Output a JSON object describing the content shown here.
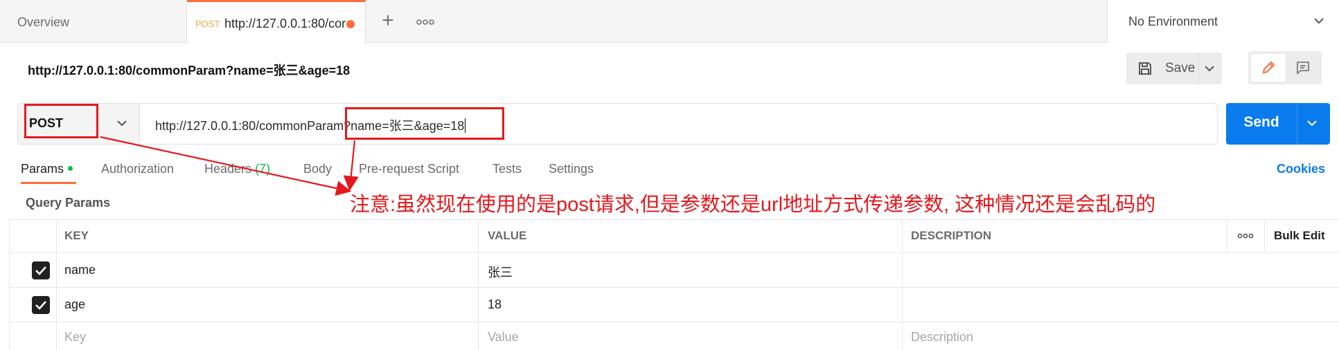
{
  "tabs": {
    "overview_label": "Overview",
    "active": {
      "method": "POST",
      "url": "http://127.0.0.1:80/cor"
    },
    "add_symbol": "+",
    "environment": "No Environment"
  },
  "request": {
    "name": "http://127.0.0.1:80/commonParam?name=张三&age=18",
    "method": "POST",
    "url": "http://127.0.0.1:80/commonParam?name=张三&age=18",
    "save_label": "Save",
    "send_label": "Send"
  },
  "request_tabs": {
    "params": "Params",
    "authorization": "Authorization",
    "headers": "Headers",
    "headers_count": "(7)",
    "body": "Body",
    "prerequest": "Pre-request Script",
    "tests": "Tests",
    "settings": "Settings",
    "cookies": "Cookies"
  },
  "query_params": {
    "title": "Query Params",
    "columns": {
      "key": "KEY",
      "value": "VALUE",
      "description": "DESCRIPTION",
      "bulk_edit": "Bulk Edit"
    },
    "rows": [
      {
        "key": "name",
        "value": "张三",
        "checked": true
      },
      {
        "key": "age",
        "value": "18",
        "checked": true
      }
    ],
    "placeholders": {
      "key": "Key",
      "value": "Value",
      "description": "Description"
    }
  },
  "annotation": {
    "text": "注意:虽然现在使用的是post请求,但是参数还是url地址方式传递参数, 这种情况还是会乱码的",
    "color": "#e5181d"
  },
  "colors": {
    "accent": "#ff6c37",
    "send": "#097bed",
    "success": "#0cbb52"
  }
}
